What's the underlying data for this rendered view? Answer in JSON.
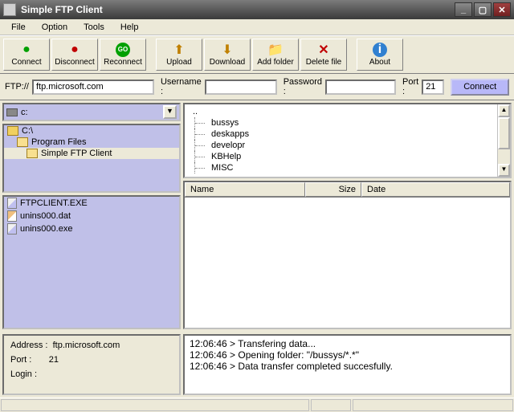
{
  "window": {
    "title": "Simple FTP Client"
  },
  "menu": {
    "file": "File",
    "option": "Option",
    "tools": "Tools",
    "help": "Help"
  },
  "toolbar": {
    "connect": "Connect",
    "disconnect": "Disconnect",
    "reconnect": "Reconnect",
    "upload": "Upload",
    "download": "Download",
    "addfolder": "Add folder",
    "deletefile": "Delete file",
    "about": "About"
  },
  "addr": {
    "ftpLabel": "FTP://",
    "ftpValue": "ftp.microsoft.com",
    "usernameLabel": "Username :",
    "usernameValue": "",
    "passwordLabel": "Password :",
    "passwordValue": "",
    "portLabel": "Port :",
    "portValue": "21",
    "connectBtn": "Connect"
  },
  "drive": {
    "selected": "c:"
  },
  "tree": [
    {
      "label": "C:\\",
      "indent": 0,
      "selected": false,
      "open": false
    },
    {
      "label": "Program Files",
      "indent": 1,
      "selected": false,
      "open": true
    },
    {
      "label": "Simple FTP Client",
      "indent": 2,
      "selected": true,
      "open": true
    }
  ],
  "localFiles": [
    {
      "name": "FTPCLIENT.EXE",
      "type": "exe"
    },
    {
      "name": "unins000.dat",
      "type": "dat"
    },
    {
      "name": "unins000.exe",
      "type": "exe"
    }
  ],
  "remoteRoot": "..",
  "remoteDirs": [
    "bussys",
    "deskapps",
    "developr",
    "KBHelp",
    "MISC"
  ],
  "columns": {
    "name": "Name",
    "size": "Size",
    "date": "Date"
  },
  "info": {
    "addrLabel": "Address :",
    "addrValue": "ftp.microsoft.com",
    "portLabel": "Port :",
    "portValue": "21",
    "loginLabel": "Login :",
    "loginValue": ""
  },
  "log": [
    "12:06:46 > Transfering data...",
    "12:06:46 > Opening folder: \"/bussys/*.*\"",
    "12:06:46 > Data transfer completed succesfully."
  ]
}
